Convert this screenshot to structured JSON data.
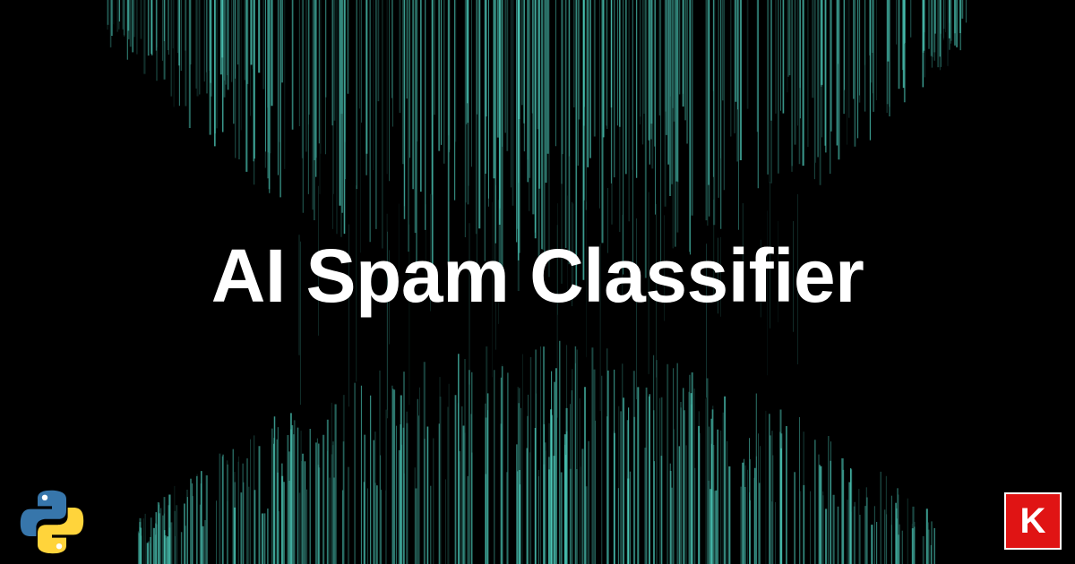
{
  "banner": {
    "title": "AI Spam Classifier",
    "badge_letter": "K"
  },
  "colors": {
    "background": "#000000",
    "streak": "#4fd1c0",
    "title": "#ffffff",
    "badge": "#e01414",
    "python_blue": "#3776ab",
    "python_yellow": "#ffd43b"
  },
  "icons": {
    "bottom_left": "python-logo-icon",
    "bottom_right": "k-logo-icon"
  }
}
